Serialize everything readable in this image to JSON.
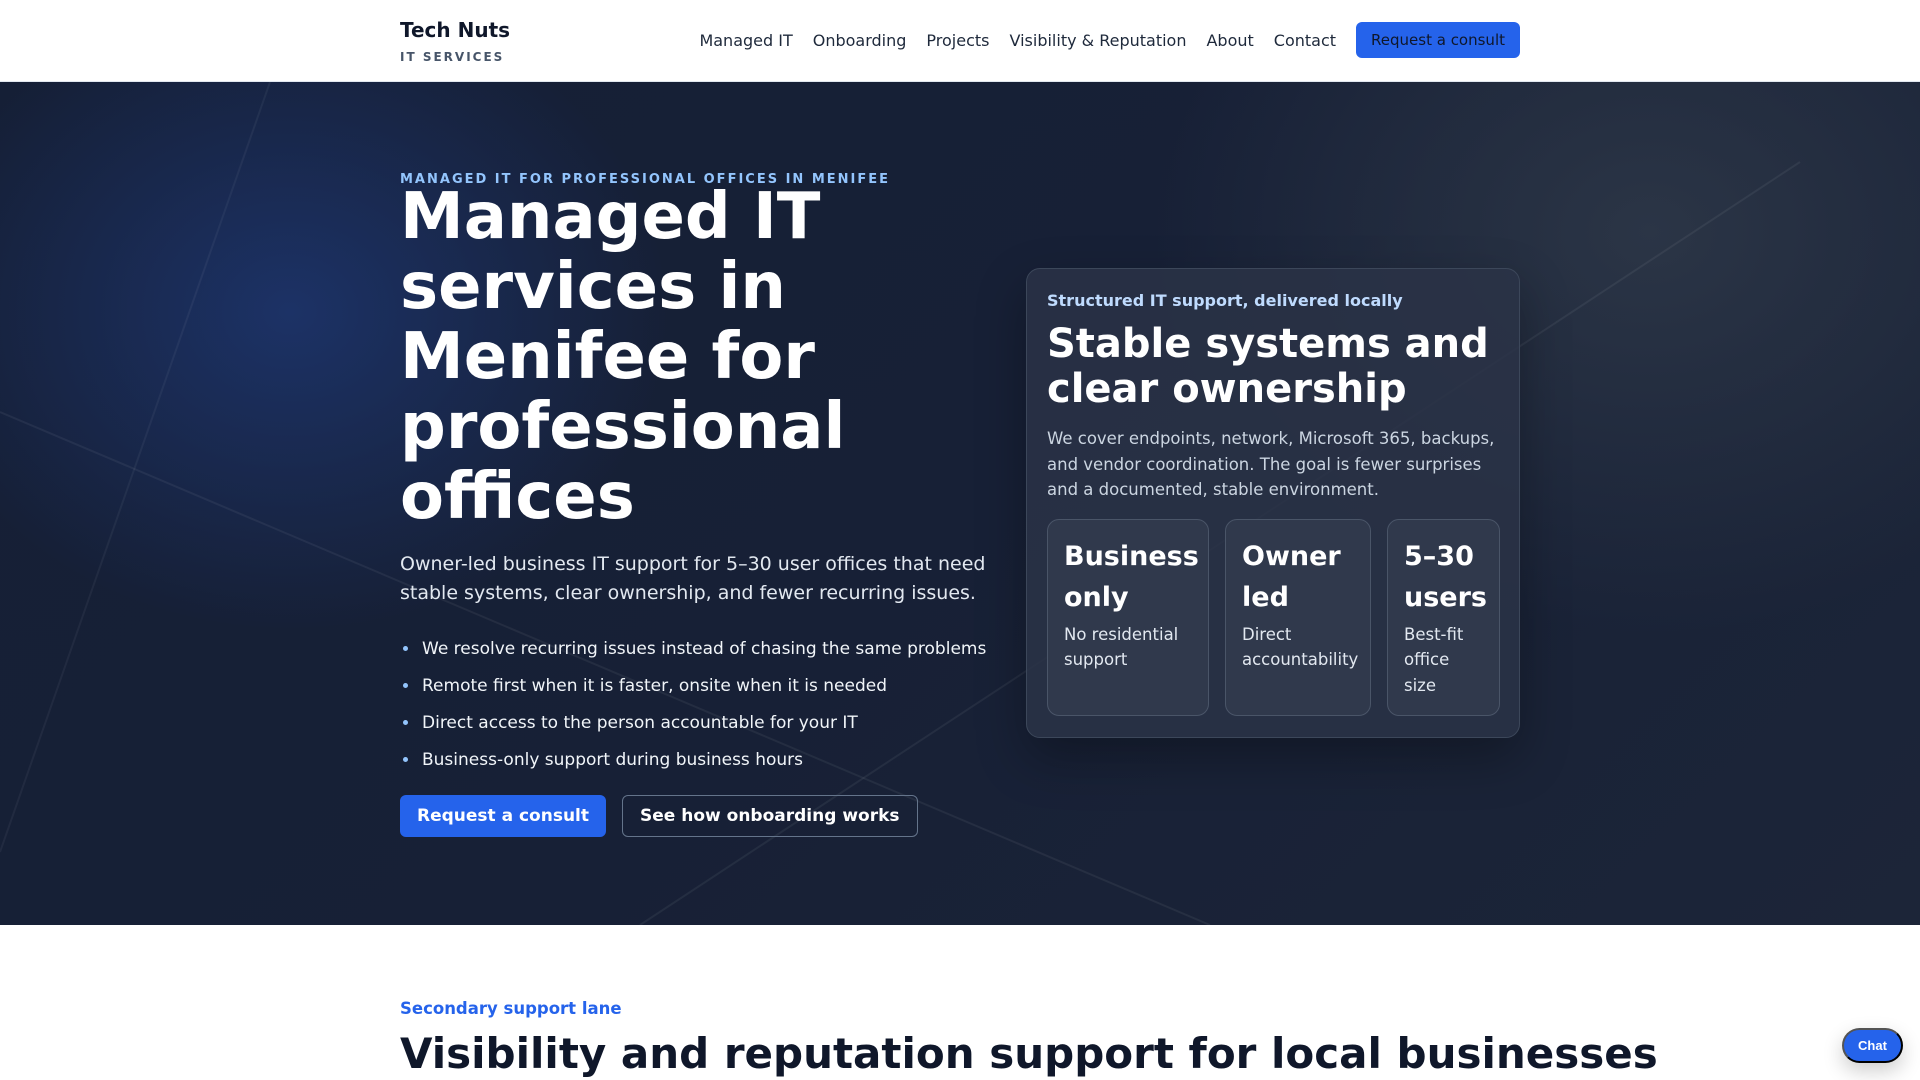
{
  "header": {
    "brand_name": "Tech Nuts",
    "brand_sub": "IT SERVICES",
    "nav": [
      "Managed IT",
      "Onboarding",
      "Projects",
      "Visibility & Reputation",
      "About",
      "Contact"
    ],
    "cta": "Request a consult"
  },
  "hero": {
    "eyebrow": "MANAGED IT FOR PROFESSIONAL OFFICES IN MENIFEE",
    "title": "Managed IT services in Menifee for professional offices",
    "lead": "Owner-led business IT support for 5–30 user offices that need stable systems, clear ownership, and fewer recurring issues.",
    "bullets": [
      "We resolve recurring issues instead of chasing the same problems",
      "Remote first when it is faster, onsite when it is needed",
      "Direct access to the person accountable for your IT",
      "Business-only support during business hours"
    ],
    "primary_button": "Request a consult",
    "secondary_button": "See how onboarding works"
  },
  "card": {
    "eyebrow": "Structured IT support, delivered locally",
    "title": "Stable systems and clear ownership",
    "text": "We cover endpoints, network, Microsoft 365, backups, and vendor coordination. The goal is fewer surprises and a documented, stable environment.",
    "stats": [
      {
        "title": "Business only",
        "text": "No residential support"
      },
      {
        "title": "Owner led",
        "text": "Direct accountability"
      },
      {
        "title": "5–30 users",
        "text": "Best-fit office size"
      }
    ]
  },
  "section": {
    "eyebrow": "Secondary support lane",
    "title": "Visibility and reputation support for local businesses"
  },
  "chat": {
    "label": "Chat"
  },
  "colors": {
    "accent": "#2563eb",
    "hero_bg": "#172036",
    "eyebrow": "#93c5fd"
  }
}
